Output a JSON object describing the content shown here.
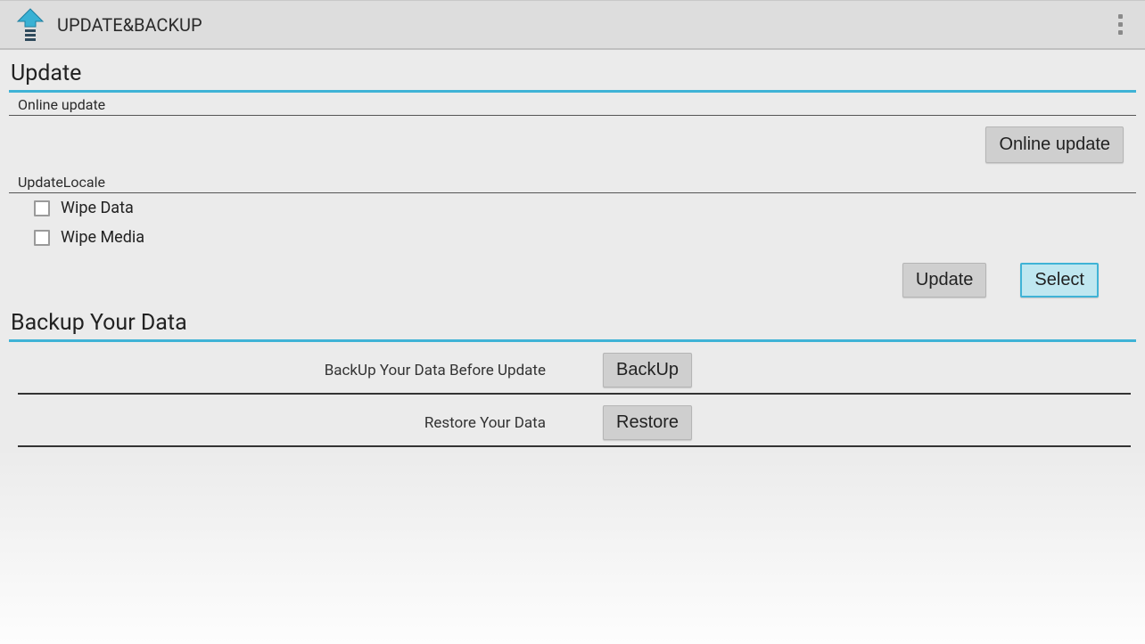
{
  "header": {
    "title": "UPDATE&BACKUP"
  },
  "sections": {
    "update": {
      "title": "Update",
      "online_update_heading": "Online update",
      "online_update_button": "Online update",
      "update_locale_heading": "UpdateLocale",
      "wipe_data_label": "Wipe Data",
      "wipe_media_label": "Wipe Media",
      "update_button": "Update",
      "select_button": "Select"
    },
    "backup": {
      "title": "Backup Your Data",
      "backup_label": "BackUp Your Data Before Update",
      "backup_button": "BackUp",
      "restore_label": "Restore Your Data",
      "restore_button": "Restore"
    }
  }
}
